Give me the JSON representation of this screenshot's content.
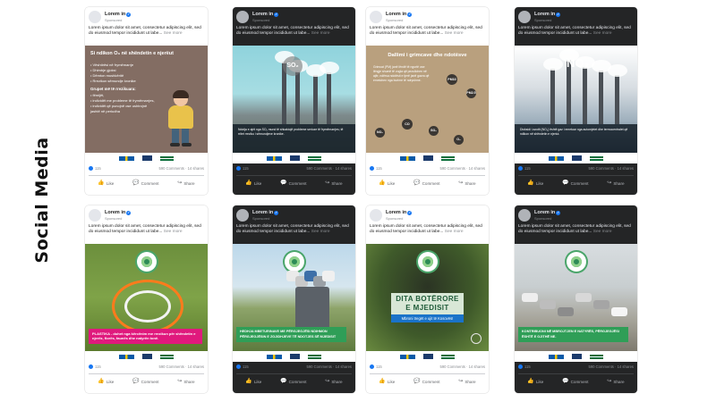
{
  "side_title": "Social Media",
  "post_common": {
    "page_name": "Lorem in",
    "sponsored": "Sponsored",
    "text": "Lorem ipsum dolor sit amet, consectetur adipiscing elit, sed do eiusmod tempor incididunt ut labe...",
    "see_more": "See more",
    "likes": "115",
    "comments_shares": "590 Comments · 14 shares",
    "like_label": "Like",
    "comment_label": "Comment",
    "share_label": "Share"
  },
  "posts": [
    {
      "theme": "light",
      "media": {
        "title": "Si ndikon O₃ në shëndetin e njerëut",
        "bullets": [
          "• Vështirësi në frymëmarrje",
          "• Dhimbje gjoksi",
          "• Dëmton mushkëritë",
          "• Rrezikon sëmundje kronike"
        ],
        "subhead": "Grupet më të rrezikuara:",
        "bullets2": [
          "• fëmijët,",
          "• individët me probleme të frymëmarrjes,",
          "• individët që punojnë ose ushtrojnë",
          "  jashtë në periudha"
        ]
      }
    },
    {
      "theme": "dark",
      "media": {
        "chem": "SO₂",
        "caption": "Ndotja e ajrit nga SO₂ mund të shkaktojë probleme serioze të frymëmarrjes; të rritet rreziku i sëmundjeve kronike."
      }
    },
    {
      "theme": "light",
      "media": {
        "title": "Dallimi i grimcave dhe ndotësve",
        "body": "Grimcat (PM) janë lëndë të ngurtë ose lëngje shumë të vogla që pezullohen në ajër, ndërsa ndotësit e tjerë janë gazra që emetohen nga burime të ndryshme.",
        "chips": [
          "PM10",
          "PM2.5",
          "NO₂",
          "CO",
          "SO₂",
          "O₃"
        ]
      }
    },
    {
      "theme": "dark",
      "media": {
        "chem": "NO₂",
        "caption": "Dioksidi i azotit (NO₂) është gaz i emetuar nga automjetet dhe termocentralet që ndikon në shëndetin e njeriut."
      }
    },
    {
      "theme": "light",
      "media": {
        "banner": "PLASTIKA - duhet nga kërcënim me rrezikun për shëndetin e njerëz, florës, faunës dhe natyrën tonë."
      }
    },
    {
      "theme": "dark",
      "media": {
        "banner": "HEDHJA MBETURINAVE ME PËRGJEGJËSI NDIHMON PËRGJEGJËSIN E ZGJIDHJEVE TË NDOTJES SË MJEDISIT"
      }
    },
    {
      "theme": "light",
      "media": {
        "line1": "DITA BOTËRORE",
        "line2": "E MJEDISIT",
        "line3": "Mbroni tregët e ujit të Kosovës!"
      }
    },
    {
      "theme": "dark",
      "media": {
        "banner": "KONTRIBUONI NË MBROJTJEN E NATYRËS, PËRGJEGJËSI ËSHTË E GJITHË NE."
      }
    }
  ],
  "colors": {
    "accent_blue": "#1877f2",
    "pink_banner": "#e0197d",
    "green_banner": "#2f9e57"
  }
}
